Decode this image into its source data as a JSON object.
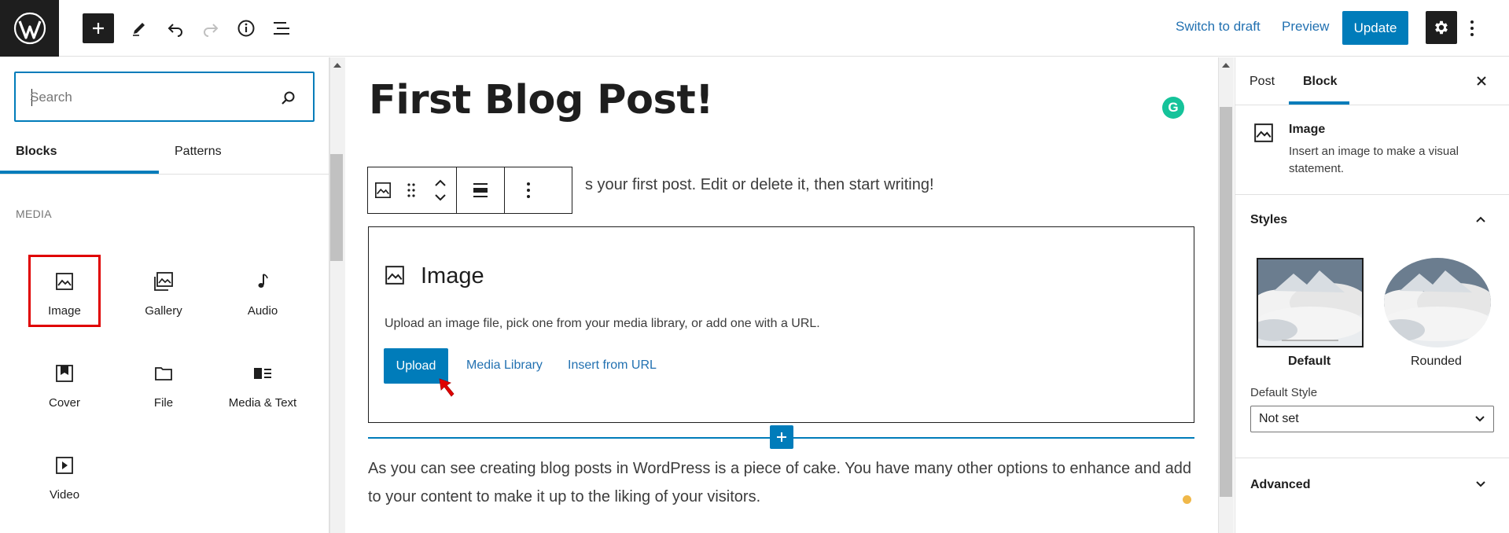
{
  "topbar": {
    "logo_icon": "wordpress-logo-icon",
    "add_block_icon": "plus-icon",
    "tools_icon": "pencil-icon",
    "undo_icon": "undo-icon",
    "redo_icon": "redo-icon",
    "details_icon": "info-icon",
    "list_view_icon": "list-view-icon",
    "switch_to_draft_label": "Switch to draft",
    "preview_label": "Preview",
    "update_label": "Update",
    "settings_icon": "gear-icon",
    "options_icon": "more-vertical-icon"
  },
  "inserter": {
    "search": {
      "placeholder": "Search",
      "value": ""
    },
    "tabs": [
      {
        "label": "Blocks",
        "active": true
      },
      {
        "label": "Patterns",
        "active": false
      }
    ],
    "category_label": "MEDIA",
    "blocks": [
      {
        "label": "Image",
        "icon": "image-icon",
        "highlighted": true
      },
      {
        "label": "Gallery",
        "icon": "gallery-icon"
      },
      {
        "label": "Audio",
        "icon": "audio-icon"
      },
      {
        "label": "Cover",
        "icon": "cover-icon"
      },
      {
        "label": "File",
        "icon": "folder-icon"
      },
      {
        "label": "Media & Text",
        "icon": "media-text-icon"
      },
      {
        "label": "Video",
        "icon": "video-icon"
      }
    ]
  },
  "editor": {
    "post_title": "First Blog Post!",
    "grammarly_badge": "G",
    "paragraph_partial": "s your first post. Edit or delete it, then start writing!",
    "block_toolbar": {
      "icons": [
        "image-icon",
        "drag-handle-icon",
        "move-up-down-icon",
        "align-icon",
        "more-vertical-icon"
      ]
    },
    "image_placeholder": {
      "title": "Image",
      "instructions": "Upload an image file, pick one from your media library, or add one with a URL.",
      "upload_label": "Upload",
      "media_library_label": "Media Library",
      "insert_url_label": "Insert from URL"
    },
    "paragraph_2": "As you can see creating blog posts in WordPress is a piece of cake. You have many other options to enhance and add to your content to make it up to the liking of your visitors."
  },
  "sidebar": {
    "tabs": [
      {
        "label": "Post",
        "active": false
      },
      {
        "label": "Block",
        "active": true
      }
    ],
    "block_card": {
      "title": "Image",
      "description": "Insert an image to make a visual statement."
    },
    "styles_panel": {
      "title": "Styles",
      "expanded": true,
      "options": [
        {
          "label": "Default",
          "selected": true
        },
        {
          "label": "Rounded",
          "selected": false
        }
      ],
      "default_style_label": "Default Style",
      "default_style_value": "Not set"
    },
    "advanced_panel": {
      "title": "Advanced",
      "expanded": false
    }
  },
  "colors": {
    "accent": "#007cba",
    "link": "#2271b1",
    "dark": "#1e1e1e",
    "highlight_border": "#e00000",
    "grammarly": "#15c39a",
    "notice_dot": "#f0b849"
  }
}
